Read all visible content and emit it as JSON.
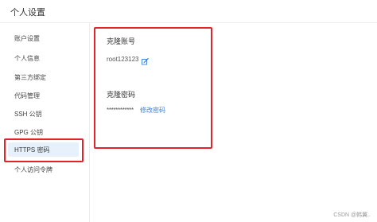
{
  "header": {
    "title": "个人设置"
  },
  "sidebar": {
    "items": [
      {
        "label": "账户设置"
      },
      {
        "label": "个人信息"
      },
      {
        "label": "第三方绑定"
      },
      {
        "label": "代码管理"
      },
      {
        "label": "SSH 公钥"
      },
      {
        "label": "GPG 公钥"
      },
      {
        "label": "HTTPS 密码"
      },
      {
        "label": "个人访问令牌"
      }
    ],
    "active_index": 6
  },
  "clone_account": {
    "title": "克隆账号",
    "value": "root123123",
    "edit_icon": "edit-icon"
  },
  "clone_password": {
    "title": "克隆密码",
    "masked_value": "************",
    "change_link": "修改密码"
  },
  "watermark": "CSDN @韩翼..",
  "colors": {
    "highlight_red": "#e0242a",
    "active_bg": "#e6f1fc",
    "link_blue": "#3d7fd6"
  }
}
